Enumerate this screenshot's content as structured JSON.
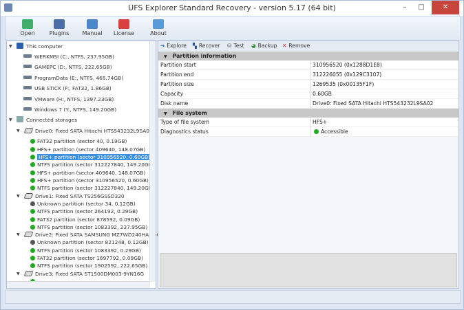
{
  "window": {
    "title": "UFS Explorer Standard Recovery - version 5.17 (64 bit)",
    "minimize": "–",
    "maximize": "□",
    "close": "✕"
  },
  "toolbar": [
    {
      "label": "Open",
      "icon": "open-folder-icon",
      "color": "#3fae6a"
    },
    {
      "label": "Plugins",
      "icon": "plugins-icon",
      "color": "#4a6fa8"
    },
    {
      "label": "Manual",
      "icon": "manual-icon",
      "color": "#4d86c9"
    },
    {
      "label": "License",
      "icon": "license-icon",
      "color": "#d94040"
    },
    {
      "label": "About",
      "icon": "about-icon",
      "color": "#5a9ad6"
    }
  ],
  "tree": {
    "computer": "This computer",
    "volumes": [
      "WERKMSI (C:, NTFS, 237.95GB)",
      "GAMEPC (D:, NTFS, 222.65GB)",
      "ProgramData (E:, NTFS, 465.74GB)",
      "USB STICK (F:, FAT32, 1.86GB)",
      "VMware (H:, NTFS, 1397.23GB)",
      "Windows 7 (Y:, NTFS, 149.20GB)"
    ],
    "storages": "Connected storages",
    "drives": [
      {
        "name": "Drive0: Fixed SATA Hitachi HTS543232L9SA02",
        "parts": [
          {
            "label": "FAT32 partition (sector 40, 0.19GB)",
            "status": "ok"
          },
          {
            "label": "HFS+ partition (sector 409640, 148.07GB)",
            "status": "ok"
          },
          {
            "label": "HFS+ partition (sector 310956520, 0.60GB)",
            "status": "ok",
            "selected": true
          },
          {
            "label": "NTFS partition (sector 312227840, 149.20GB)",
            "status": "ok"
          },
          {
            "label": "HFS+ partition (sector 409640, 148.07GB)",
            "status": "ok"
          },
          {
            "label": "HFS+ partition (sector 310956520, 0.60GB)",
            "status": "ok"
          },
          {
            "label": "NTFS partition (sector 312227840, 149.20GB)",
            "status": "ok"
          }
        ]
      },
      {
        "name": "Drive1: Fixed SATA TS256GSSD320",
        "parts": [
          {
            "label": "Unknown partition (sector 34, 0.12GB)",
            "status": "unknown"
          },
          {
            "label": "NTFS partition (sector 264192, 0.29GB)",
            "status": "ok"
          },
          {
            "label": "FAT32 partition (sector 878592, 0.09GB)",
            "status": "ok"
          },
          {
            "label": "NTFS partition (sector 1083392, 237.95GB)",
            "status": "ok"
          }
        ]
      },
      {
        "name": "Drive2: Fixed SATA SAMSUNG MZ7WD240HAFV-0",
        "parts": [
          {
            "label": "Unknown partition (sector 821248, 0.12GB)",
            "status": "unknown"
          },
          {
            "label": "NTFS partition (sector 1083392, 0.29GB)",
            "status": "ok"
          },
          {
            "label": "FAT32 partition (sector 1697792, 0.09GB)",
            "status": "ok"
          },
          {
            "label": "NTFS partition (sector 1902592, 222.65GB)",
            "status": "ok"
          }
        ]
      },
      {
        "name": "Drive3: Fixed SATA ST1500DM003-9YN16G",
        "parts": []
      }
    ]
  },
  "actions": [
    {
      "label": "Explore",
      "icon": "arrow-right-icon",
      "glyph": "➔",
      "color": "#2a6fd0"
    },
    {
      "label": "Recover",
      "icon": "recover-icon",
      "glyph": "▚",
      "color": "#2a4f90"
    },
    {
      "label": "Test",
      "icon": "test-icon",
      "glyph": "⛁",
      "color": "#444"
    },
    {
      "label": "Backup",
      "icon": "backup-icon",
      "glyph": "◕",
      "color": "#3a8a3a"
    },
    {
      "label": "Remove",
      "icon": "remove-icon",
      "glyph": "✕",
      "color": "#d03030"
    }
  ],
  "partition_info": {
    "title": "Partition information",
    "rows": [
      [
        "Partition start",
        "310956520 (0x1288D1E8)"
      ],
      [
        "Partition end",
        "312226055 (0x129C3107)"
      ],
      [
        "Partition size",
        "1269535 (0x00135F1F)"
      ],
      [
        "Capacity",
        "0.60GB"
      ],
      [
        "Disk name",
        "Drive0: Fixed SATA Hitachi HTS543232L9SA02"
      ]
    ]
  },
  "file_system": {
    "title": "File system",
    "rows": [
      [
        "Type of file system",
        "HFS+"
      ],
      [
        "Diagnostics status",
        "Accessible"
      ]
    ]
  },
  "colors": {
    "ok": "#21a821",
    "unknown": "#555555",
    "selection": "#3b8ee0"
  }
}
